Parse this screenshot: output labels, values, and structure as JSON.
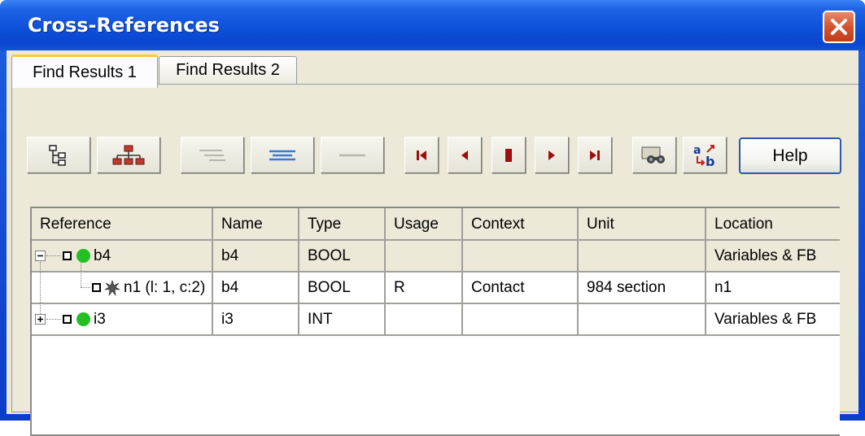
{
  "window": {
    "title": "Cross-References"
  },
  "tabs": [
    {
      "label": "Find Results 1",
      "active": true
    },
    {
      "label": "Find Results 2",
      "active": false
    }
  ],
  "toolbar": {
    "buttons": [
      {
        "icon": "tree-view-icon"
      },
      {
        "icon": "hierarchy-icon"
      },
      {
        "icon": "expand-lines-icon",
        "disabled": true
      },
      {
        "icon": "collapse-lines-icon"
      },
      {
        "icon": "flat-line-icon",
        "disabled": true
      },
      {
        "icon": "first-icon"
      },
      {
        "icon": "previous-icon"
      },
      {
        "icon": "stop-icon"
      },
      {
        "icon": "next-icon"
      },
      {
        "icon": "last-icon"
      },
      {
        "icon": "binoculars-icon"
      },
      {
        "icon": "replace-ab-icon"
      }
    ],
    "help_label": "Help"
  },
  "table": {
    "columns": [
      "Reference",
      "Name",
      "Type",
      "Usage",
      "Context",
      "Unit",
      "Location"
    ],
    "rows": [
      {
        "reference": "b4",
        "name": "b4",
        "type": "BOOL",
        "usage": "",
        "context": "",
        "unit": "",
        "location": "Variables & FB",
        "expanded": true,
        "level": 0
      },
      {
        "reference": "n1 (l: 1, c:2)",
        "name": "b4",
        "type": "BOOL",
        "usage": "R",
        "context": "Contact",
        "unit": "984 section",
        "location": "n1",
        "level": 1
      },
      {
        "reference": "i3",
        "name": "i3",
        "type": "INT",
        "usage": "",
        "context": "",
        "unit": "",
        "location": "Variables & FB",
        "expanded": false,
        "level": 0
      }
    ]
  },
  "colors": {
    "titlebar": "#0d4fd8",
    "face": "#ece9d8",
    "variable_dot": "#22c022",
    "tab_highlight": "#ffc83c"
  }
}
